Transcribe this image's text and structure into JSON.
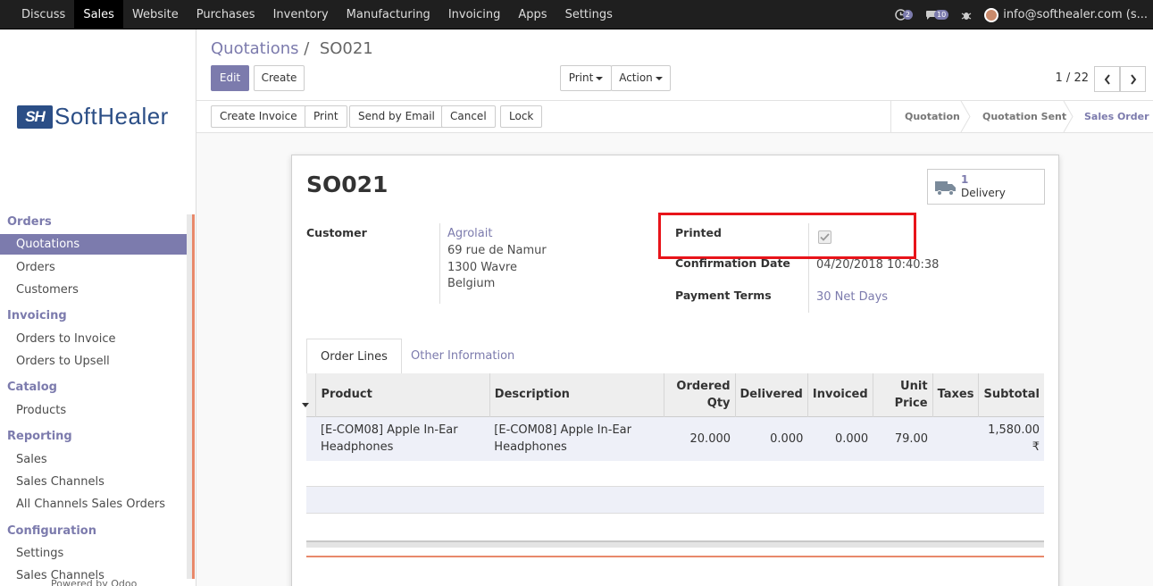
{
  "topbar": {
    "menu": [
      "Discuss",
      "Sales",
      "Website",
      "Purchases",
      "Inventory",
      "Manufacturing",
      "Invoicing",
      "Apps",
      "Settings"
    ],
    "active_menu": "Sales",
    "activity_count": "2",
    "messages_count": "10",
    "user": "info@softhealer.com (s..."
  },
  "sidebar": {
    "logo_mark": "SH",
    "logo_text": "SoftHealer",
    "sections": {
      "orders": "Orders",
      "invoicing": "Invoicing",
      "catalog": "Catalog",
      "reporting": "Reporting",
      "configuration": "Configuration"
    },
    "items": {
      "quotations": "Quotations",
      "orders": "Orders",
      "customers": "Customers",
      "orders_to_invoice": "Orders to Invoice",
      "orders_to_upsell": "Orders to Upsell",
      "products": "Products",
      "sales": "Sales",
      "sales_channels": "Sales Channels",
      "all_channels": "All Channels Sales Orders",
      "settings": "Settings",
      "config_sales_channels": "Sales Channels"
    },
    "powered_by": "Powered by Odoo"
  },
  "control_panel": {
    "breadcrumb_parent": "Quotations",
    "breadcrumb_sep": "/",
    "breadcrumb_current": "SO021",
    "edit": "Edit",
    "create": "Create",
    "print": "Print",
    "action": "Action",
    "pager": "1 / 22"
  },
  "statusbar": {
    "buttons": [
      "Create Invoice",
      "Print",
      "Send by Email",
      "Cancel",
      "Lock"
    ],
    "stages": [
      "Quotation",
      "Quotation Sent",
      "Sales Order"
    ],
    "current_stage": "Sales Order"
  },
  "form": {
    "name": "SO021",
    "smart_button": {
      "count": "1",
      "label": "Delivery"
    },
    "customer_label": "Customer",
    "customer_name": "Agrolait",
    "address_line1": "69 rue de Namur",
    "address_line2": "1300 Wavre",
    "address_line3": "Belgium",
    "printed_label": "Printed",
    "printed_checked": true,
    "confirmation_label": "Confirmation Date",
    "confirmation_value": "04/20/2018 10:40:38",
    "payment_terms_label": "Payment Terms",
    "payment_terms_value": "30 Net Days",
    "tabs": [
      "Order Lines",
      "Other Information"
    ],
    "table": {
      "headers": {
        "product": "Product",
        "description": "Description",
        "ordered_qty_1": "Ordered",
        "ordered_qty_2": "Qty",
        "delivered": "Delivered",
        "invoiced": "Invoiced",
        "unit_price_1": "Unit",
        "unit_price_2": "Price",
        "taxes": "Taxes",
        "subtotal": "Subtotal"
      },
      "rows": [
        {
          "product_1": "[E-COM08] Apple In-Ear",
          "product_2": "Headphones",
          "description_1": "[E-COM08] Apple In-Ear",
          "description_2": "Headphones",
          "ordered_qty": "20.000",
          "delivered": "0.000",
          "invoiced": "0.000",
          "unit_price": "79.00",
          "taxes": "",
          "subtotal": "1,580.00 ₹"
        }
      ]
    }
  },
  "colors": {
    "accent": "#7c7bad",
    "highlight_box": "#e8141a",
    "topbar": "#1f1f1f"
  }
}
